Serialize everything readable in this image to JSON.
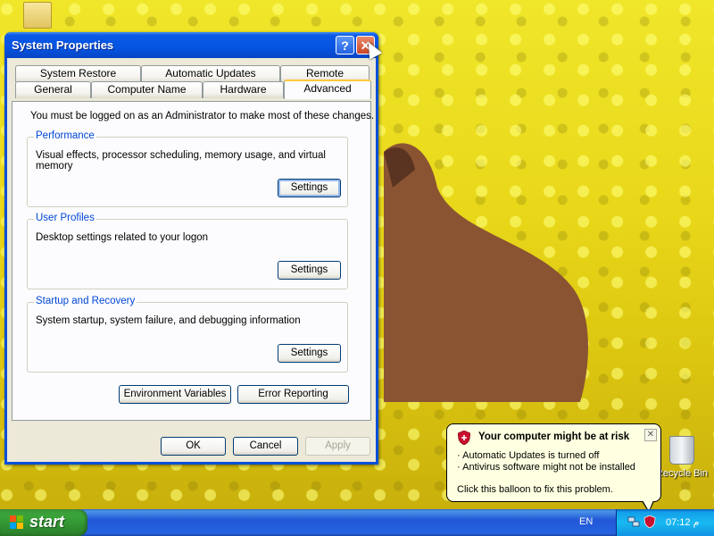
{
  "window": {
    "title": "System Properties",
    "help_symbol": "?",
    "close_symbol": "✕"
  },
  "tabs": {
    "row1": [
      "System Restore",
      "Automatic Updates",
      "Remote"
    ],
    "row2": [
      "General",
      "Computer Name",
      "Hardware",
      "Advanced"
    ],
    "active": "Advanced"
  },
  "advanced": {
    "admin_note": "You must be logged on as an Administrator to make most of these changes.",
    "performance": {
      "legend": "Performance",
      "description": "Visual effects, processor scheduling, memory usage, and virtual memory",
      "button": "Settings"
    },
    "user_profiles": {
      "legend": "User Profiles",
      "description": "Desktop settings related to your logon",
      "button": "Settings"
    },
    "startup_recovery": {
      "legend": "Startup and Recovery",
      "description": "System startup, system failure, and debugging information",
      "button": "Settings"
    },
    "environment_variables": "Environment Variables",
    "error_reporting": "Error Reporting"
  },
  "dialog_buttons": {
    "ok": "OK",
    "cancel": "Cancel",
    "apply": "Apply"
  },
  "desktop": {
    "recycle_bin_label": "Recycle Bin"
  },
  "taskbar": {
    "start_label": "start",
    "language": "EN",
    "clock": "07:12 م"
  },
  "balloon": {
    "title": "Your computer might be at risk",
    "line1": "· Automatic Updates is turned off",
    "line2": "· Antivirus software might not be installed",
    "line3": "Click this balloon to fix this problem.",
    "close_symbol": "✕"
  },
  "icons": [
    "help-icon",
    "close-icon",
    "shield-icon",
    "recycle-bin-icon",
    "windows-flag-icon",
    "network-icon",
    "folder-icon",
    "mouse-cursor-icon"
  ]
}
